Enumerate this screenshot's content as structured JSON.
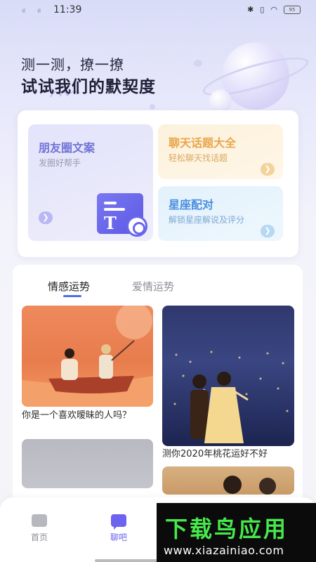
{
  "status_bar": {
    "signal_left": "·ıll",
    "signal_right": "·ıll",
    "time": "11:39",
    "icons": [
      "bluetooth-icon",
      "vibrate-icon",
      "wifi-icon",
      "battery-icon"
    ],
    "battery": "95"
  },
  "hero": {
    "line1": "测一测，撩一撩",
    "line2": "试试我们的默契度"
  },
  "feature_tiles": [
    {
      "title": "朋友圈文案",
      "subtitle": "发圈好帮手",
      "title_color": "#7274d8",
      "icon": "text-scan-icon"
    },
    {
      "title": "聊天话题大全",
      "subtitle": "轻松聊天找话题",
      "title_color": "#e8a64a",
      "icon": "arrow-right-icon"
    },
    {
      "title": "星座配对",
      "subtitle": "解锁星座解说及评分",
      "title_color": "#4a8fe0",
      "icon": "arrow-right-icon"
    }
  ],
  "tabs": [
    {
      "label": "情感运势",
      "active": true
    },
    {
      "label": "爱情运势",
      "active": false
    }
  ],
  "articles": [
    {
      "caption": "你是一个喜欢暧昧的人吗？"
    },
    {
      "caption": "测你2020年桃花运好不好"
    }
  ],
  "bottom_nav": [
    {
      "label": "首页",
      "icon": "home-icon",
      "active": false
    },
    {
      "label": "聊吧",
      "icon": "chat-icon",
      "active": true
    }
  ],
  "watermark": {
    "title": "下载鸟应用",
    "url": "www.xiazainiao.com"
  },
  "colors": {
    "accent": "#6c63ee",
    "tab_underline": "#4a72e0",
    "watermark_green": "#46e84c"
  }
}
